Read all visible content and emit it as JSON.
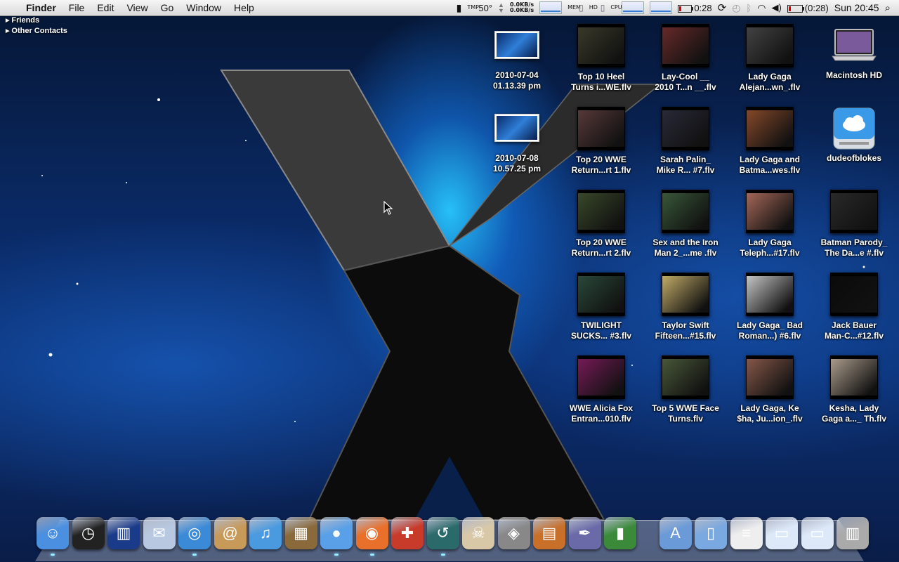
{
  "menubar": {
    "apple_glyph": "",
    "app_name": "Finder",
    "menus": [
      "File",
      "Edit",
      "View",
      "Go",
      "Window",
      "Help"
    ],
    "status": {
      "tmp_label": "TMP",
      "temperature": "50°",
      "net_up": "0.0KB/s",
      "net_down": "0.0KB/s",
      "mem_label": "MEM",
      "hd_label": "HD",
      "cpu_label": "CPU",
      "battery_time": "0:28",
      "battery_remaining": "(0:28)",
      "clock": "Sun 20:45"
    }
  },
  "contacts": {
    "groups": [
      "Friends",
      "Other Contacts"
    ]
  },
  "desktop": {
    "screenshots": [
      {
        "line1": "2010-07-04",
        "line2": "01.13.39 pm"
      },
      {
        "line1": "2010-07-08",
        "line2": "10.57.25 pm"
      }
    ],
    "videos": [
      {
        "line1": "Top 10 Heel",
        "line2": "Turns i...WE.flv",
        "color": "#3a3a2a"
      },
      {
        "line1": "Lay-Cool __",
        "line2": "2010 T...n __.flv",
        "color": "#6a2a2a"
      },
      {
        "line1": "Lady Gaga",
        "line2": "Alejan...wn_.flv",
        "color": "#444444"
      },
      {
        "line1": "Top 20 WWE",
        "line2": "Return...rt 1.flv",
        "color": "#5a3a3a"
      },
      {
        "line1": "Sarah Palin_",
        "line2": "Mike R... #7.flv",
        "color": "#2a2a3a"
      },
      {
        "line1": "Lady Gaga and",
        "line2": "Batma...wes.flv",
        "color": "#8a4a2a"
      },
      {
        "line1": "Top 20 WWE",
        "line2": "Return...rt 2.flv",
        "color": "#3a4a2a"
      },
      {
        "line1": "Sex and the Iron",
        "line2": "Man 2_...me .flv",
        "color": "#3a5a3a"
      },
      {
        "line1": "Lady Gaga",
        "line2": "Teleph...#17.flv",
        "color": "#aa6a5a"
      },
      {
        "line1": "Batman Parody_",
        "line2": "The Da...e #.flv",
        "color": "#2a2a2a"
      },
      {
        "line1": "TWILIGHT",
        "line2": "SUCKS... #3.flv",
        "color": "#2a4a3a"
      },
      {
        "line1": "Taylor Swift",
        "line2": "Fifteen...#15.flv",
        "color": "#c8b06a"
      },
      {
        "line1": "Lady Gaga_ Bad",
        "line2": "Roman...) #6.flv",
        "color": "#cccccc"
      },
      {
        "line1": "Jack Bauer",
        "line2": "Man-C...#12.flv",
        "color": "#0a0a0a"
      },
      {
        "line1": "WWE Alicia Fox",
        "line2": "Entran...010.flv",
        "color": "#7a1a5a"
      },
      {
        "line1": "Top 5 WWE Face",
        "line2": "Turns.flv",
        "color": "#4a5a3a"
      },
      {
        "line1": "Lady Gaga, Ke",
        "line2": "$ha, Ju...ion_.flv",
        "color": "#8a5a4a"
      },
      {
        "line1": "Kesha, Lady",
        "line2": "Gaga a..._ Th.flv",
        "color": "#b0a090"
      }
    ],
    "drives": [
      {
        "label": "Macintosh HD"
      },
      {
        "label": "dudeofblokes"
      }
    ]
  },
  "dock": {
    "items": [
      {
        "name": "finder-icon",
        "glyph": "☺",
        "bg": "#4a8fe0",
        "running": true
      },
      {
        "name": "dashboard-icon",
        "glyph": "◷",
        "bg": "#222222",
        "running": false
      },
      {
        "name": "tardis-icon",
        "glyph": "▥",
        "bg": "#1a3a8a",
        "running": false
      },
      {
        "name": "mail-stamp-icon",
        "glyph": "✉",
        "bg": "#b8c8e0",
        "running": false
      },
      {
        "name": "safari-icon",
        "glyph": "◎",
        "bg": "#3a8ad8",
        "running": true
      },
      {
        "name": "address-book-icon",
        "glyph": "@",
        "bg": "#c89a5a",
        "running": false
      },
      {
        "name": "itunes-icon",
        "glyph": "♫",
        "bg": "#4a9ae0",
        "running": false
      },
      {
        "name": "iphoto-icon",
        "glyph": "▦",
        "bg": "#8a6a3a",
        "running": false
      },
      {
        "name": "messenger-icon",
        "glyph": "●",
        "bg": "#5aa0e8",
        "running": true
      },
      {
        "name": "firefox-icon",
        "glyph": "◉",
        "bg": "#e8702a",
        "running": true
      },
      {
        "name": "transmission-icon",
        "glyph": "✚",
        "bg": "#c83a2a",
        "running": false
      },
      {
        "name": "time-machine-icon",
        "glyph": "↺",
        "bg": "#2a6a6a",
        "running": true
      },
      {
        "name": "skull-icon",
        "glyph": "☠",
        "bg": "#d8c8a8",
        "running": false
      },
      {
        "name": "growl-icon",
        "glyph": "◈",
        "bg": "#888888",
        "running": false
      },
      {
        "name": "keynote-icon",
        "glyph": "▤",
        "bg": "#c8702a",
        "running": false
      },
      {
        "name": "script-editor-icon",
        "glyph": "✒",
        "bg": "#6a6aa8",
        "running": false
      },
      {
        "name": "numbers-icon",
        "glyph": "▮",
        "bg": "#3a8a3a",
        "running": false
      },
      {
        "name": "applications-folder-icon",
        "glyph": "A",
        "bg": "#6a9ad8",
        "running": false
      },
      {
        "name": "documents-folder-icon",
        "glyph": "▯",
        "bg": "#7aa8e0",
        "running": false
      },
      {
        "name": "text-document-icon",
        "glyph": "≡",
        "bg": "#eeeeee",
        "running": false
      },
      {
        "name": "screenshot-stack-icon",
        "glyph": "▭",
        "bg": "#dde8f8",
        "running": false
      },
      {
        "name": "downloads-stack-icon",
        "glyph": "▭",
        "bg": "#dde8f8",
        "running": false
      },
      {
        "name": "trash-icon",
        "glyph": "▥",
        "bg": "#aaaaaa",
        "running": false
      }
    ]
  }
}
